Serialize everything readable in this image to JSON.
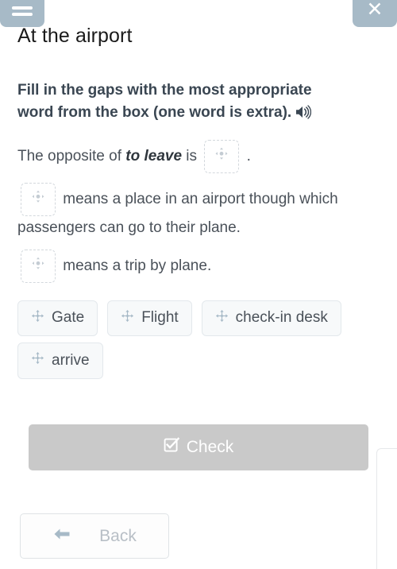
{
  "header": {
    "menu_icon": "hamburger-menu-icon",
    "close_icon": "close-x-icon",
    "title": "At the airport"
  },
  "exercise": {
    "instruction": "Fill in the gaps with the most appropriate word from the box (one word is extra).",
    "audio_icon": "speaker-audio-icon",
    "slot_icon": "move-arrows-icon",
    "sentences": [
      {
        "id": "sentence-1",
        "before": "The opposite of ",
        "emphasis": "to leave",
        "middle": " is ",
        "slot_value": "",
        "after": " ."
      },
      {
        "id": "sentence-2",
        "before": "",
        "emphasis": "",
        "middle": "",
        "slot_value": "",
        "after": "  means a place in an airport though which passengers can go to their plane."
      },
      {
        "id": "sentence-3",
        "before": "",
        "emphasis": "",
        "middle": "",
        "slot_value": "",
        "after": " means a trip by plane."
      }
    ]
  },
  "word_bank": {
    "drag_icon": "move-arrows-icon",
    "words": [
      {
        "label": "Gate"
      },
      {
        "label": "Flight"
      },
      {
        "label": "check-in desk"
      },
      {
        "label": "arrive"
      }
    ]
  },
  "actions": {
    "check_label": "Check",
    "check_icon": "checkbox-checked-icon",
    "check_disabled": true,
    "back_label": "Back",
    "back_icon": "arrow-left-icon"
  },
  "colors": {
    "chrome_button": "#a7bac7",
    "check_button": "#c9c9c9",
    "instruction_text": "#3a4652",
    "body_text": "#4a5159",
    "drag_icon": "#a7bac7",
    "slot_border": "#d3d8dd",
    "chip_bg": "#f7f9fa"
  }
}
